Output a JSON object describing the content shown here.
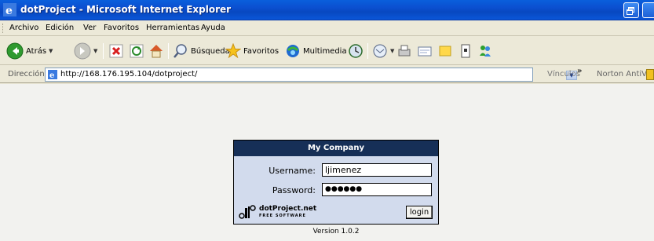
{
  "window": {
    "title": "dotProject - Microsoft Internet Explorer"
  },
  "menu": {
    "items": [
      {
        "label": "Archivo"
      },
      {
        "label": "Edición"
      },
      {
        "label": "Ver"
      },
      {
        "label": "Favoritos"
      },
      {
        "label": "Herramientas"
      },
      {
        "label": "Ayuda"
      }
    ]
  },
  "toolbar": {
    "back_label": "Atrás",
    "search_label": "Búsqueda",
    "favorites_label": "Favoritos",
    "multimedia_label": "Multimedia"
  },
  "address": {
    "label": "Dirección",
    "url": "http://168.176.195.104/dotproject/",
    "links_label": "Vínculos",
    "norton_label": "Norton AntiVirus"
  },
  "login": {
    "company": "My Company",
    "username_label": "Username:",
    "username_value": "ljimenez",
    "password_label": "Password:",
    "password_mask": "●●●●●●",
    "button_label": "login",
    "logo_title": "dotProject.net",
    "logo_subtitle": "FREE SOFTWARE",
    "version": "Version 1.0.2"
  },
  "colors": {
    "title_bar": "#0b4fd0",
    "login_header": "#162f57",
    "login_body": "#d2dbed",
    "page_bg": "#f2f2ef"
  }
}
